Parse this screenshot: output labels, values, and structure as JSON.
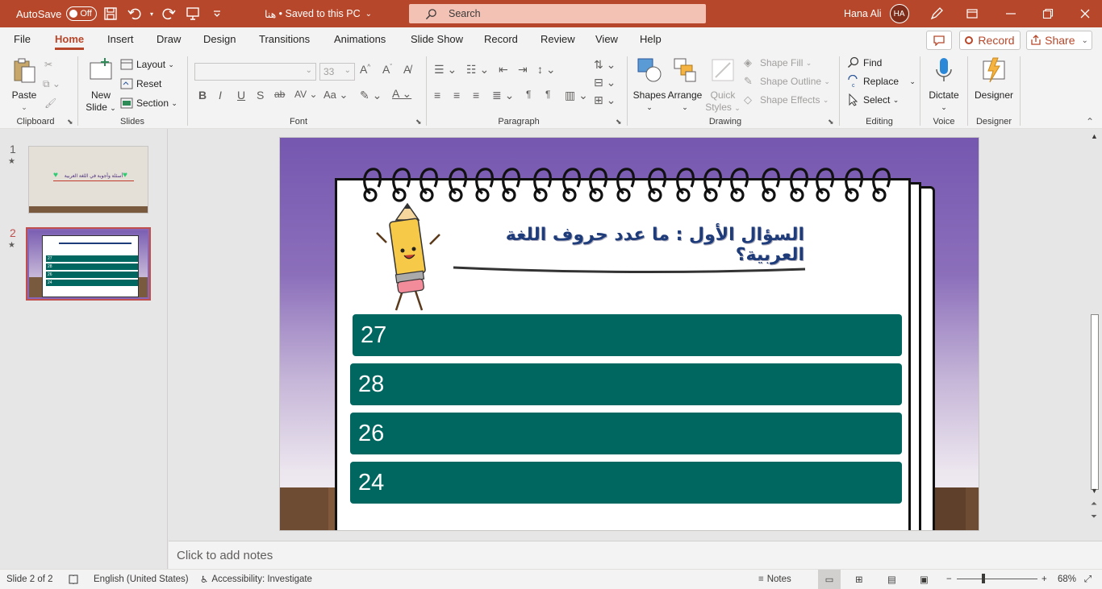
{
  "titlebar": {
    "autosave_label": "AutoSave",
    "autosave_state": "Off",
    "doc_name": "هنا",
    "save_state": "• Saved to this PC",
    "search_placeholder": "Search",
    "user_name": "Hana Ali",
    "user_initials": "HA",
    "accent": "#b7472a"
  },
  "menu": {
    "tabs": [
      "File",
      "Home",
      "Insert",
      "Draw",
      "Design",
      "Transitions",
      "Animations",
      "Slide Show",
      "Record",
      "Review",
      "View",
      "Help"
    ],
    "active": "Home",
    "record_label": "Record",
    "share_label": "Share"
  },
  "ribbon": {
    "clipboard": {
      "paste": "Paste",
      "label": "Clipboard"
    },
    "slides": {
      "new_slide_1": "New",
      "new_slide_2": "Slide",
      "layout": "Layout",
      "reset": "Reset",
      "section": "Section",
      "label": "Slides"
    },
    "font": {
      "size": "33",
      "label": "Font"
    },
    "paragraph": {
      "label": "Paragraph"
    },
    "drawing": {
      "shapes": "Shapes",
      "arrange": "Arrange",
      "quick_1": "Quick",
      "quick_2": "Styles",
      "shape_fill": "Shape Fill",
      "shape_outline": "Shape Outline",
      "shape_effects": "Shape Effects",
      "label": "Drawing"
    },
    "editing": {
      "find": "Find",
      "replace": "Replace",
      "select": "Select",
      "label": "Editing"
    },
    "voice": {
      "dictate": "Dictate",
      "label": "Voice"
    },
    "designer": {
      "designer": "Designer",
      "label": "Designer"
    }
  },
  "thumbnails": [
    {
      "number": "1",
      "title": "أسئلة وأجوبة في اللغة العربية"
    },
    {
      "number": "2",
      "answers": [
        "27",
        "28",
        "26",
        "24"
      ]
    }
  ],
  "slide": {
    "question": "السؤال الأول : ما عدد حروف اللغة العربية؟",
    "answers": [
      "27",
      "28",
      "26",
      "24"
    ],
    "answer_color": "#006660"
  },
  "notes_placeholder": "Click to add notes",
  "status": {
    "slide_info": "Slide 2 of 2",
    "language": "English (United States)",
    "accessibility": "Accessibility: Investigate",
    "notes": "Notes",
    "zoom": "68%"
  }
}
